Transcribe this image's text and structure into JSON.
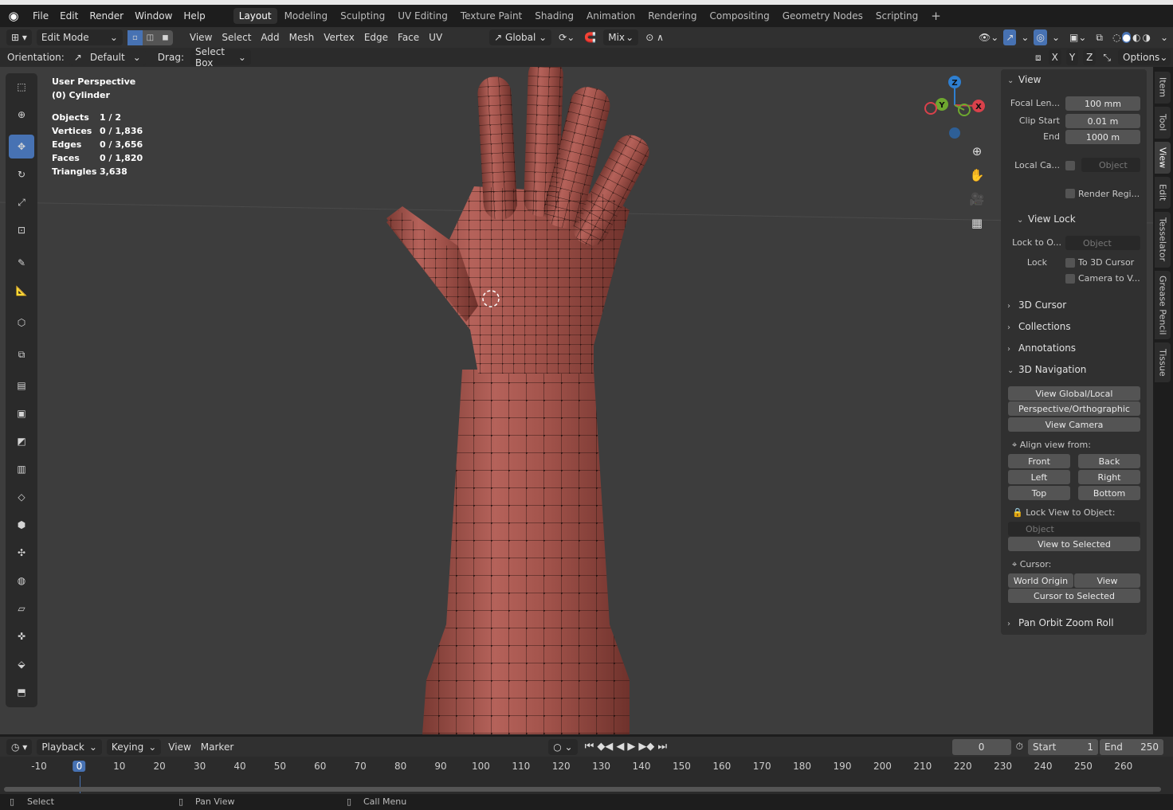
{
  "menubar": {
    "items": [
      "File",
      "Edit",
      "Render",
      "Window",
      "Help"
    ],
    "workspaces": [
      "Layout",
      "Modeling",
      "Sculpting",
      "UV Editing",
      "Texture Paint",
      "Shading",
      "Animation",
      "Rendering",
      "Compositing",
      "Geometry Nodes",
      "Scripting"
    ],
    "active_workspace": "Layout",
    "add_tab": "+"
  },
  "header": {
    "mode": "Edit Mode",
    "menus": [
      "View",
      "Select",
      "Add",
      "Mesh",
      "Vertex",
      "Edge",
      "Face",
      "UV"
    ],
    "transform": "Global",
    "proportional": "Mix"
  },
  "toolhdr": {
    "orientation_label": "Orientation:",
    "orientation": "Default",
    "drag_label": "Drag:",
    "drag": "Select Box",
    "axes": [
      "X",
      "Y",
      "Z"
    ],
    "options": "Options"
  },
  "stats": {
    "view": "User Perspective",
    "object": "(0) Cylinder",
    "rows": [
      {
        "k": "Objects",
        "v": "1 / 2"
      },
      {
        "k": "Vertices",
        "v": "0 / 1,836"
      },
      {
        "k": "Edges",
        "v": "0 / 3,656"
      },
      {
        "k": "Faces",
        "v": "0 / 1,820"
      },
      {
        "k": "Triangles",
        "v": "3,638"
      }
    ]
  },
  "gizmo": {
    "x": "X",
    "y": "Y",
    "z": "Z"
  },
  "npanel": {
    "view_title": "View",
    "focal_label": "Focal Len...",
    "focal": "100 mm",
    "clip_start_label": "Clip Start",
    "clip_start": "0.01 m",
    "clip_end_label": "End",
    "clip_end": "1000 m",
    "local_cam_label": "Local Ca...",
    "local_cam_ph": "Object",
    "render_region": "Render Regi...",
    "view_lock_title": "View Lock",
    "lock_obj_label": "Lock to O...",
    "lock_obj_ph": "Object",
    "lock_label": "Lock",
    "to_cursor": "To 3D Cursor",
    "cam_to_view": "Camera to V...",
    "cursor3d": "3D Cursor",
    "collections": "Collections",
    "annotations": "Annotations",
    "nav_title": "3D Navigation",
    "view_global": "View Global/Local",
    "persp": "Perspective/Orthographic",
    "view_camera": "View Camera",
    "align_label": "Align view from:",
    "front": "Front",
    "back": "Back",
    "left": "Left",
    "right": "Right",
    "top": "Top",
    "bottom": "Bottom",
    "lock_view_label": "Lock View to Object:",
    "lock_view_ph": "Object",
    "view_selected": "View to Selected",
    "cursor_label": "Cursor:",
    "world_origin": "World Origin",
    "view": "View",
    "cursor_selected": "Cursor to Selected",
    "pan_orbit": "Pan Orbit Zoom Roll"
  },
  "tabs": [
    "Item",
    "Tool",
    "View",
    "Edit",
    "Tesselator",
    "Grease Pencil",
    "Tissue"
  ],
  "active_tab": "View",
  "timeline": {
    "menus": [
      "Playback",
      "Keying",
      "View",
      "Marker"
    ],
    "current": "0",
    "start_label": "Start",
    "start": "1",
    "end_label": "End",
    "end": "250",
    "ticks": [
      "-10",
      "0",
      "10",
      "20",
      "30",
      "40",
      "50",
      "60",
      "70",
      "80",
      "90",
      "100",
      "110",
      "120",
      "130",
      "140",
      "150",
      "160",
      "170",
      "180",
      "190",
      "200",
      "210",
      "220",
      "230",
      "240",
      "250",
      "260"
    ]
  },
  "status": {
    "select": "Select",
    "pan": "Pan View",
    "call": "Call Menu"
  }
}
